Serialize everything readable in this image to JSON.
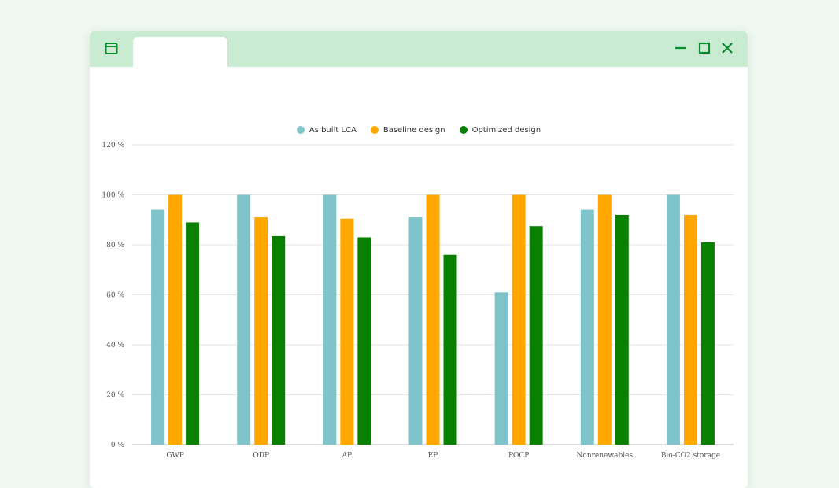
{
  "window": {
    "controls": {
      "minimize_icon": "minimize-icon",
      "maximize_icon": "maximize-icon",
      "close_icon": "close-icon"
    },
    "accent_color": "#0e8a2e",
    "titlebar_color": "#c9ebd2"
  },
  "chart_data": {
    "type": "bar",
    "categories": [
      "GWP",
      "ODP",
      "AP",
      "EP",
      "POCP",
      "Nonrenewables",
      "Bio-CO2 storage"
    ],
    "series": [
      {
        "name": "As built LCA",
        "color": "#7fc3cb",
        "values": [
          94,
          100,
          100,
          91,
          61,
          94,
          100
        ]
      },
      {
        "name": "Baseline design",
        "color": "#ffa600",
        "values": [
          100,
          91,
          90.5,
          100,
          100,
          100,
          92
        ]
      },
      {
        "name": "Optimized design",
        "color": "#0a8000",
        "values": [
          89,
          83.5,
          83,
          76,
          87.5,
          92,
          81
        ]
      }
    ],
    "yticks": [
      "0 %",
      "20 %",
      "40 %",
      "60 %",
      "80 %",
      "100 %",
      "120 %"
    ],
    "ylim": [
      0,
      120
    ],
    "grid": true,
    "legend_position": "top-center"
  }
}
